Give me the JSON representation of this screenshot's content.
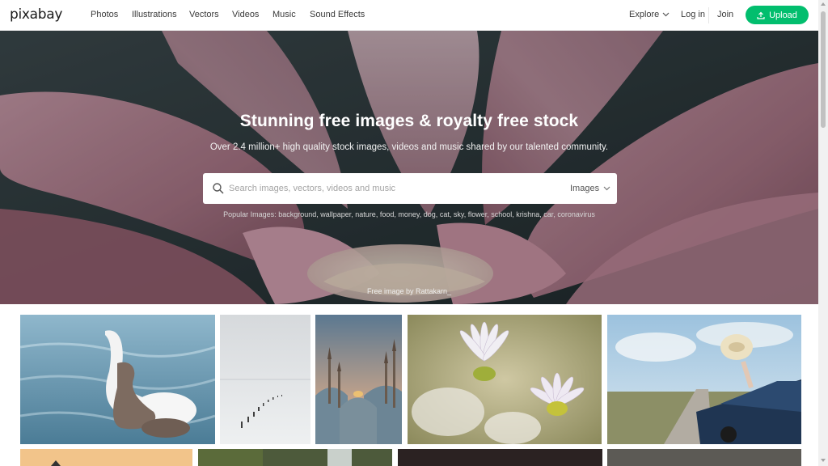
{
  "nav": {
    "logo": "pixabay",
    "links": [
      "Photos",
      "Illustrations",
      "Vectors",
      "Videos",
      "Music",
      "Sound Effects"
    ],
    "explore": "Explore",
    "login": "Log in",
    "join": "Join",
    "upload": "Upload"
  },
  "hero": {
    "title": "Stunning free images & royalty free stock",
    "subtitle": "Over 2.4 million+ high quality stock images, videos and music shared by our talented community.",
    "search_placeholder": "Search images, vectors, videos and music",
    "search_type": "Images",
    "popular_label": "Popular Images:",
    "popular_tags": [
      "background",
      "wallpaper",
      "nature",
      "food",
      "money",
      "dog",
      "cat",
      "sky",
      "flower",
      "school",
      "krishna",
      "car",
      "coronavirus"
    ],
    "credit": "Free image by Rattakarn_"
  },
  "gallery": {
    "photos": [
      "swan-photo",
      "misty-lake-photo",
      "mosque-photo",
      "daisy-flowers-photo",
      "car-hat-photo"
    ]
  },
  "colors": {
    "accent": "#02be6e",
    "hero_bg": "#2e3b3f",
    "petal": "#c4869a"
  }
}
